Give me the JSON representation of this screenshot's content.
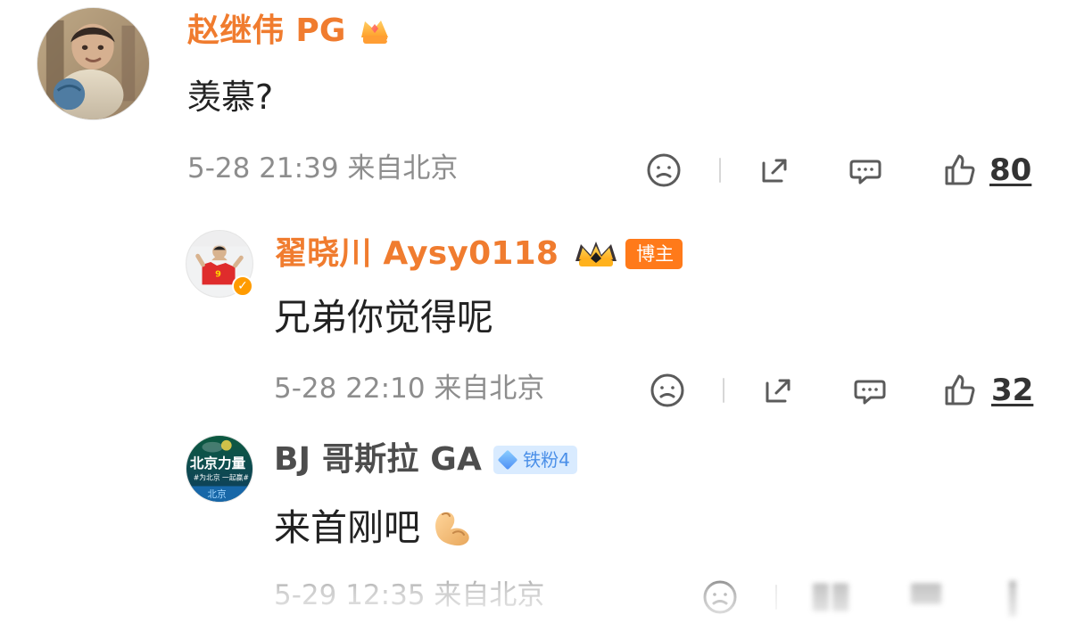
{
  "comments": [
    {
      "author": "赵继伟 PG",
      "content": "羡慕?",
      "meta": "5-28 21:39 来自北京",
      "likes": "80",
      "badge": "crown-icon"
    },
    {
      "author": "翟晓川 Aysy0118",
      "content": "兄弟你觉得呢",
      "meta": "5-28 22:10 来自北京",
      "likes": "32",
      "badge": "博主"
    },
    {
      "author": "BJ 哥斯拉 GA",
      "content": "来首刚吧",
      "meta": "5-29 12:35 来自北京",
      "badge": "铁粉4"
    }
  ],
  "avatars": {
    "first": "child-photo-avatar",
    "second": "basketball-player-avatar",
    "third": "beijing-power-avatar",
    "third_text_line1": "北京力量",
    "third_text_line2": "#为北京 一起赢#",
    "third_text_bottom": "北京"
  },
  "icons": {
    "face": "sad-face-icon",
    "share": "share-icon",
    "comment": "comment-icon",
    "like": "like-icon",
    "muscle": "flexed-biceps-emoji",
    "verified": "verified-badge-icon"
  }
}
